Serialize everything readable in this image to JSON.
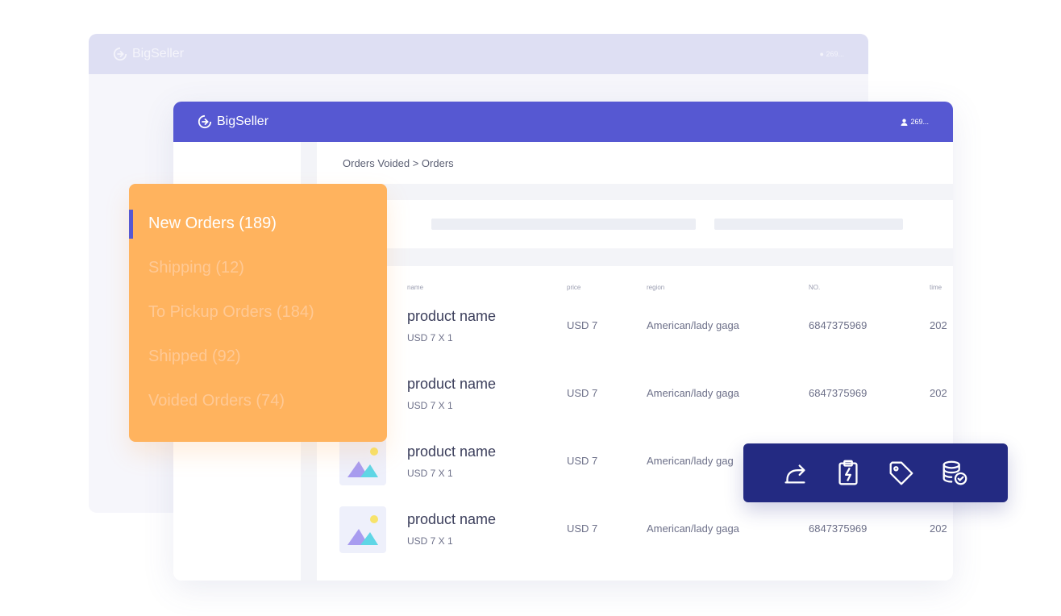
{
  "back_window": {
    "brand": "BigSeller",
    "user": "269..."
  },
  "header": {
    "brand": "BigSeller",
    "user": "269..."
  },
  "breadcrumb": "Orders Voided > Orders",
  "status_menu": {
    "items": [
      {
        "label": "New Orders (189)",
        "active": true
      },
      {
        "label": "Shipping (12)",
        "active": false
      },
      {
        "label": "To Pickup Orders (184)",
        "active": false
      },
      {
        "label": "Shipped (92)",
        "active": false
      },
      {
        "label": "Voided Orders (74)",
        "active": false
      }
    ]
  },
  "table": {
    "columns": [
      "name",
      "price",
      "region",
      "NO.",
      "time"
    ],
    "rows": [
      {
        "name": "product name",
        "sub": "USD 7 X 1",
        "price": "USD 7",
        "region": "American/lady gaga",
        "no": "6847375969",
        "time": "202"
      },
      {
        "name": "product name",
        "sub": "USD 7 X 1",
        "price": "USD 7",
        "region": "American/lady gaga",
        "no": "6847375969",
        "time": "202"
      },
      {
        "name": "product name",
        "sub": "USD 7 X 1",
        "price": "USD 7",
        "region": "American/lady gag",
        "no": "",
        "time": ""
      },
      {
        "name": "product name",
        "sub": "USD 7 X 1",
        "price": "USD 7",
        "region": "American/lady gaga",
        "no": "6847375969",
        "time": "202"
      }
    ]
  },
  "action_bar": {
    "icons": [
      "share-icon",
      "clipboard-bolt-icon",
      "tag-icon",
      "coins-check-icon"
    ]
  },
  "colors": {
    "primary": "#5658d2",
    "orange": "#ffb35e",
    "navy": "#232a82"
  }
}
